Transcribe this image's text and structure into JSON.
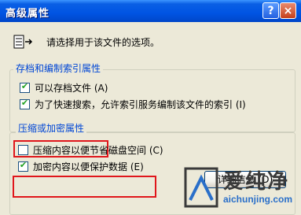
{
  "window": {
    "title": "高级属性",
    "help_label": "?",
    "close_label": "×"
  },
  "intro": {
    "text": "请选择用于该文件的选项。"
  },
  "archive_group": {
    "legend": "存档和编制索引属性",
    "items": [
      {
        "label": "可以存档文件 (A)",
        "checked": true
      },
      {
        "label": "为了快速搜索，允许索引服务编制该文件的索引 (I)",
        "checked": true
      }
    ]
  },
  "compress_group": {
    "legend": "压缩或加密属性",
    "items": [
      {
        "label": "压缩内容以便节省磁盘空间 (C)",
        "checked": false
      },
      {
        "label": "加密内容以便保护数据 (E)",
        "checked": true
      }
    ],
    "details_label": "详细信息 (D)"
  },
  "watermark": {
    "brand": "爱纯净",
    "url": "aichunjing.com"
  },
  "colors": {
    "title_bar": "#0054e3",
    "legend_text": "#0046d5",
    "highlight_box": "#e0161b",
    "checkmark": "#21a121"
  }
}
